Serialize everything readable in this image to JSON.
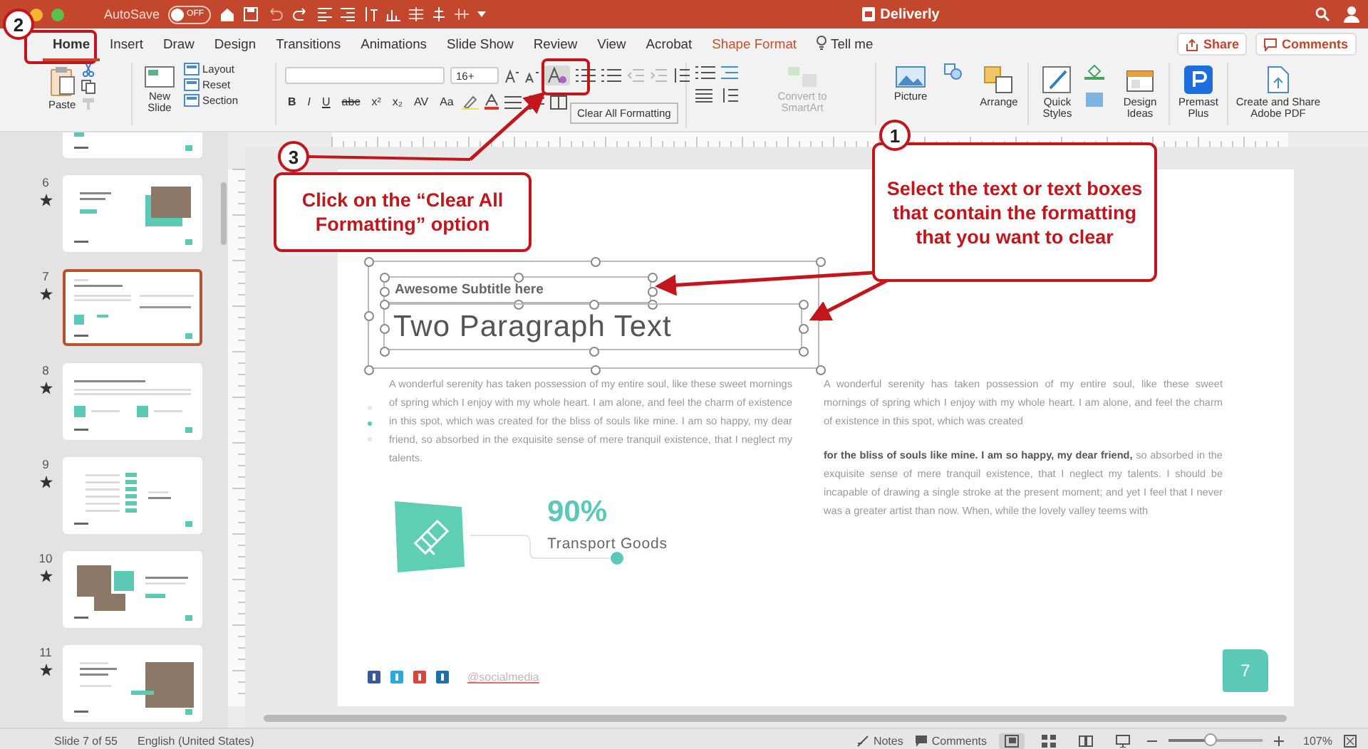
{
  "title_bar": {
    "autosave_label": "AutoSave",
    "autosave_state": "OFF",
    "autosave_on": false,
    "document_title": "Deliverly"
  },
  "tabs": [
    {
      "label": "Home",
      "selected": true,
      "kind": "tab"
    },
    {
      "label": "Insert",
      "selected": false,
      "kind": "tab"
    },
    {
      "label": "Draw",
      "selected": false,
      "kind": "tab"
    },
    {
      "label": "Design",
      "selected": false,
      "kind": "tab"
    },
    {
      "label": "Transitions",
      "selected": false,
      "kind": "tab"
    },
    {
      "label": "Animations",
      "selected": false,
      "kind": "tab"
    },
    {
      "label": "Slide Show",
      "selected": false,
      "kind": "tab"
    },
    {
      "label": "Review",
      "selected": false,
      "kind": "tab"
    },
    {
      "label": "View",
      "selected": false,
      "kind": "tab"
    },
    {
      "label": "Acrobat",
      "selected": false,
      "kind": "tab"
    },
    {
      "label": "Shape Format",
      "selected": false,
      "kind": "contextual"
    },
    {
      "label": "Tell me",
      "selected": false,
      "kind": "search"
    }
  ],
  "share_button": "Share",
  "comments_button": "Comments",
  "ribbon": {
    "paste": "Paste",
    "new_slide": "New Slide",
    "slide_options": [
      "Layout",
      "Reset",
      "Section"
    ],
    "font_size": "16+",
    "format_buttons": [
      "B",
      "I",
      "U",
      "abc",
      "x²",
      "x₂",
      "AV",
      "Aa"
    ],
    "clear_formatting": {
      "tooltip": "Clear All Formatting"
    },
    "smartart": {
      "label": "Convert to SmartArt",
      "disabled": true
    },
    "big_buttons": [
      {
        "label": "Picture",
        "kind": "picture"
      },
      {
        "label": "Arrange",
        "kind": "arrange"
      },
      {
        "label": "Quick Styles",
        "kind": "styles"
      },
      {
        "label": "Design Ideas",
        "kind": "ideas"
      },
      {
        "label": "Premast Plus",
        "kind": "premast"
      },
      {
        "label": "Create and Share Adobe PDF",
        "kind": "pdf"
      }
    ]
  },
  "thumbnails": [
    {
      "selected": false,
      "kind": "text"
    },
    {
      "number": "6",
      "transition": true,
      "selected": false,
      "kind": "photo-right"
    },
    {
      "number": "7",
      "transition": true,
      "selected": true,
      "kind": "text"
    },
    {
      "number": "8",
      "transition": true,
      "selected": false,
      "kind": "two-icons"
    },
    {
      "number": "9",
      "transition": true,
      "selected": false,
      "kind": "list"
    },
    {
      "number": "10",
      "transition": true,
      "selected": false,
      "kind": "photos-left"
    },
    {
      "number": "11",
      "transition": true,
      "selected": false,
      "kind": "person-photo"
    }
  ],
  "slide": {
    "subtitle": "Awesome Subtitle here",
    "title": "Two Paragraph Text",
    "left_paragraph": "A wonderful serenity has taken possession of my entire soul, like these sweet mornings of spring which I enjoy with my whole heart. I am alone, and feel the charm of existence in this spot, which was created for the bliss of souls like mine. I am so happy, my dear friend, so absorbed in the exquisite sense of mere tranquil existence, that I neglect my talents.",
    "stat_value": "90%",
    "stat_label": "Transport Goods",
    "right_paragraphs": [
      "A wonderful serenity has taken possession of my entire soul, like these sweet mornings of spring which I enjoy with my whole heart. I am alone, and feel the charm of existence in this spot, which was created",
      "**for the bliss of souls like mine. I am so happy, my dear friend,** so absorbed in the exquisite sense of mere tranquil existence, that I neglect my talents. I should be incapable of drawing a single stroke at the present moment; and yet I feel that I never was a greater artist than now. When, while the lovely valley teems with"
    ],
    "social_icons": [
      {
        "color": "#3b5998"
      },
      {
        "color": "#2aa9e0"
      },
      {
        "color": "#d9473b"
      },
      {
        "color": "#1f6fa8"
      }
    ],
    "social_handle": "@socialmedia",
    "page_number": "7"
  },
  "status_bar": {
    "slide_position": "Slide 7 of 55",
    "language": "English (United States)",
    "notes": "Notes",
    "comments": "Comments",
    "views": [
      {
        "kind": "normal",
        "selected": true
      },
      {
        "kind": "sorter",
        "selected": false
      },
      {
        "kind": "reading",
        "selected": false
      },
      {
        "kind": "slideshow",
        "selected": false
      }
    ],
    "zoom": {
      "level": 0.45
    },
    "zoom_percent": "107%"
  },
  "annotations": [
    {
      "number": "2"
    },
    {
      "number": "3",
      "text": "Click on the “Clear All Formatting” option"
    },
    {
      "number": "1",
      "text": "Select the text or text boxes that contain the formatting that you want to clear"
    }
  ]
}
